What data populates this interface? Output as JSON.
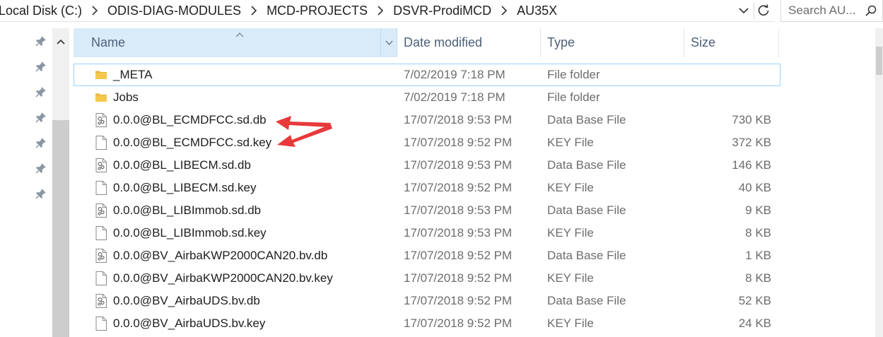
{
  "address": {
    "crumbs": [
      "Local Disk (C:)",
      "ODIS-DIAG-MODULES",
      "MCD-PROJECTS",
      "DSVR-ProdiMCD",
      "AU35X"
    ]
  },
  "search": {
    "placeholder": "Search AU..."
  },
  "columns": {
    "name": "Name",
    "date": "Date modified",
    "type": "Type",
    "size": "Size"
  },
  "files": [
    {
      "name": "_META",
      "date": "7/02/2019 7:18 PM",
      "type": "File folder",
      "size": "",
      "icon": "folder-icon"
    },
    {
      "name": "Jobs",
      "date": "7/02/2019 7:18 PM",
      "type": "File folder",
      "size": "",
      "icon": "folder-icon"
    },
    {
      "name": "0.0.0@BL_ECMDFCC.sd.db",
      "date": "17/07/2018 9:53 PM",
      "type": "Data Base File",
      "size": "730 KB",
      "icon": "db-file-icon"
    },
    {
      "name": "0.0.0@BL_ECMDFCC.sd.key",
      "date": "17/07/2018 9:52 PM",
      "type": "KEY File",
      "size": "372 KB",
      "icon": "file-icon"
    },
    {
      "name": "0.0.0@BL_LIBECM.sd.db",
      "date": "17/07/2018 9:53 PM",
      "type": "Data Base File",
      "size": "146 KB",
      "icon": "db-file-icon"
    },
    {
      "name": "0.0.0@BL_LIBECM.sd.key",
      "date": "17/07/2018 9:52 PM",
      "type": "KEY File",
      "size": "40 KB",
      "icon": "file-icon"
    },
    {
      "name": "0.0.0@BL_LIBImmob.sd.db",
      "date": "17/07/2018 9:53 PM",
      "type": "Data Base File",
      "size": "9 KB",
      "icon": "db-file-icon"
    },
    {
      "name": "0.0.0@BL_LIBImmob.sd.key",
      "date": "17/07/2018 9:53 PM",
      "type": "KEY File",
      "size": "8 KB",
      "icon": "file-icon"
    },
    {
      "name": "0.0.0@BV_AirbaKWP2000CAN20.bv.db",
      "date": "17/07/2018 9:52 PM",
      "type": "Data Base File",
      "size": "1 KB",
      "icon": "db-file-icon"
    },
    {
      "name": "0.0.0@BV_AirbaKWP2000CAN20.bv.key",
      "date": "17/07/2018 9:52 PM",
      "type": "KEY File",
      "size": "8 KB",
      "icon": "file-icon"
    },
    {
      "name": "0.0.0@BV_AirbaUDS.bv.db",
      "date": "17/07/2018 9:52 PM",
      "type": "Data Base File",
      "size": "52 KB",
      "icon": "db-file-icon"
    },
    {
      "name": "0.0.0@BV_AirbaUDS.bv.key",
      "date": "17/07/2018 9:52 PM",
      "type": "KEY File",
      "size": "24 KB",
      "icon": "file-icon"
    }
  ],
  "colors": {
    "header_selected": "#d9ebf9",
    "folder": "#e8b33a",
    "annotation_arrow": "#e8393a",
    "focus_border": "#99d1ff"
  }
}
